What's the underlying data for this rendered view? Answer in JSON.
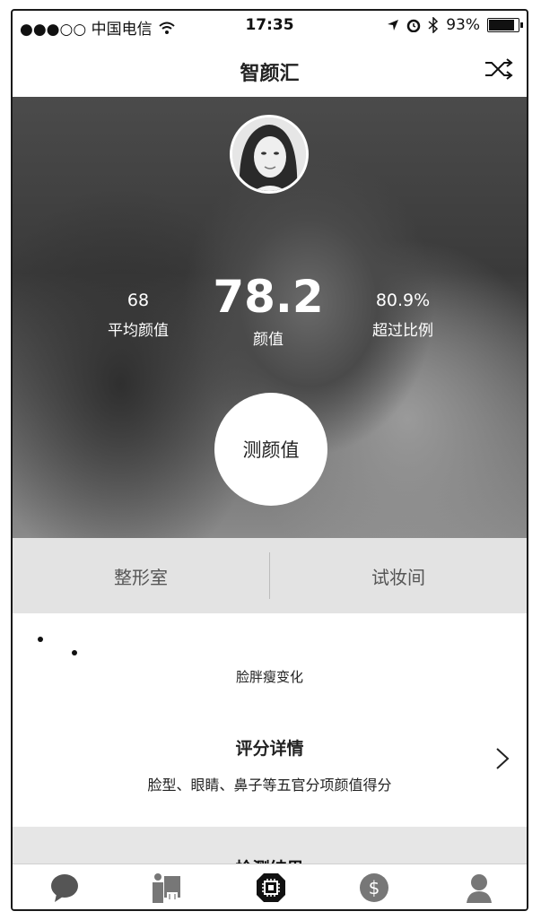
{
  "status_bar": {
    "carrier": "●●●○○ 中国电信",
    "time": "17:35",
    "battery": "93%",
    "battery_level": 0.93
  },
  "nav": {
    "title": "智颜汇",
    "shuffle_icon": "shuffle-icon"
  },
  "stats": {
    "average": {
      "value": "68",
      "label": "平均颜值"
    },
    "score": {
      "value": "78.2",
      "label": "颜值"
    },
    "exceed": {
      "value": "80.9%",
      "label": "超过比例"
    }
  },
  "measure_button": "测颜值",
  "tabs": [
    {
      "label": "整形室"
    },
    {
      "label": "试妆间"
    }
  ],
  "face_change": {
    "label": "脸胖瘦变化"
  },
  "score_details": {
    "title": "评分详情",
    "subtitle": "脸型、眼睛、鼻子等五官分项颜值得分"
  },
  "results": {
    "title": "检测结果"
  },
  "tabbar": [
    {
      "icon": "chat-bubble-icon"
    },
    {
      "icon": "presenter-icon"
    },
    {
      "icon": "chip-icon"
    },
    {
      "icon": "dollar-icon"
    },
    {
      "icon": "user-icon"
    }
  ]
}
